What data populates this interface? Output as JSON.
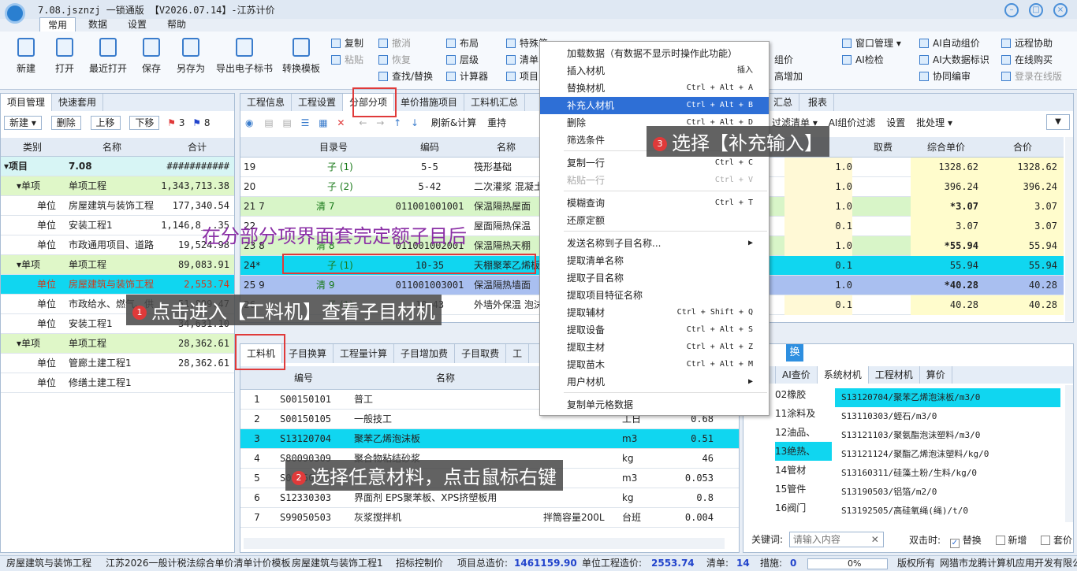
{
  "app": {
    "title": "7.08.jsznzj 一锁通版 【V2026.07.14】-江苏计价"
  },
  "menu": [
    "常用",
    "数据",
    "设置",
    "帮助"
  ],
  "ribbon": {
    "big": [
      "新建",
      "打开",
      "最近打开",
      "保存",
      "另存为",
      "导出电子标书",
      "转换模板"
    ],
    "small_col1": [
      "复制",
      "粘贴"
    ],
    "small_col2": [
      "撤消",
      "恢复",
      "查找/替换"
    ],
    "small_col3": [
      "布局",
      "层级",
      "计算器"
    ],
    "small_col4": [
      "特殊简…",
      "清单",
      "项目"
    ],
    "small_right1": [
      "窗口管理",
      "AI检检"
    ],
    "small_right2": [
      "AI自动组价",
      "AI大数据标识",
      "协同编审"
    ],
    "small_right3": [
      "远程协助",
      "在线购买",
      "登录在线版"
    ],
    "partial": [
      "组价",
      "高增加"
    ]
  },
  "left": {
    "tabs": [
      "项目管理",
      "快速套用"
    ],
    "toolbar": [
      "新建",
      "删除",
      "上移",
      "下移",
      "3",
      "8"
    ],
    "headers": [
      "类别",
      "名称",
      "合计"
    ],
    "rows": [
      {
        "cat": "项目",
        "name": "7.08",
        "total": "###########"
      },
      {
        "cat": "单项",
        "name": "单项工程",
        "total": "1,343,713.38"
      },
      {
        "cat": "单位",
        "name": "房屋建筑与装饰工程",
        "total": "177,340.54"
      },
      {
        "cat": "单位",
        "name": "安装工程1",
        "total": "1,146,8__.35"
      },
      {
        "cat": "单位",
        "name": "市政通用项目、道路",
        "total": "19,524.98"
      },
      {
        "cat": "单项",
        "name": "单项工程",
        "total": "89,083.91"
      },
      {
        "cat": "单位",
        "name": "房屋建筑与装饰工程",
        "total": "2,553.74"
      },
      {
        "cat": "单位",
        "name": "市政给水、燃气、供",
        "total": "51,899.47"
      },
      {
        "cat": "单位",
        "name": "安装工程1",
        "total": "34,631.10"
      },
      {
        "cat": "单项",
        "name": "单项工程",
        "total": "28,362.61"
      },
      {
        "cat": "单位",
        "name": "管廊土建工程1",
        "total": "28,362.61"
      },
      {
        "cat": "单位",
        "name": "修缮土建工程1",
        "total": ""
      }
    ]
  },
  "center": {
    "tabs": [
      "工程信息",
      "工程设置",
      "分部分项",
      "单价措施项目",
      "工料机汇总"
    ],
    "tabs_right": [
      "汇总",
      "报表"
    ],
    "toolbar": [
      "刷新&计算",
      "重持"
    ],
    "toolbar_right": [
      "过滤清单",
      "AI组价过滤",
      "设置",
      "批处理"
    ],
    "headers": [
      "目录号",
      "编码",
      "名称"
    ],
    "headers_right": [
      "",
      "取费",
      "综合单价",
      "合价"
    ],
    "rows": [
      {
        "no": "19",
        "dir": "子  (1)",
        "code": "5-5",
        "name": "筏形基础",
        "qty": "1.0",
        "unit": "1328.62",
        "total": "1328.62"
      },
      {
        "no": "20",
        "dir": "子  (2)",
        "code": "5-42",
        "name": "二次灌浆 混凝土",
        "qty": "1.0",
        "unit": "396.24",
        "total": "396.24"
      },
      {
        "no": "21 7",
        "dir": "清  7",
        "code": "011001001001",
        "name": "保温隔热屋面",
        "qty": "1.0",
        "unit": "*3.07",
        "total": "3.07"
      },
      {
        "no": "22",
        "dir": "",
        "code": "",
        "name": "屋面隔热保温",
        "qty": "0.1",
        "unit": "3.07",
        "total": "3.07"
      },
      {
        "no": "23 8",
        "dir": "清  8",
        "code": "011001002001",
        "name": "保温隔热天棚",
        "qty": "1.0",
        "unit": "*55.94",
        "total": "55.94"
      },
      {
        "no": "24*",
        "dir": "子  (1)",
        "code": "10-35",
        "name": "天棚聚苯乙烯板",
        "qty": "0.1",
        "unit": "55.94",
        "total": "55.94"
      },
      {
        "no": "25 9",
        "dir": "清  9",
        "code": "011001003001",
        "name": "保温隔热墙面",
        "qty": "1.0",
        "unit": "*40.28",
        "total": "40.28"
      },
      {
        "no": "26",
        "dir": "子  (1)",
        "code": "10-43",
        "name": "外墙外保温 泡沫",
        "qty": "0.1",
        "unit": "40.28",
        "total": "40.28"
      }
    ]
  },
  "bottom": {
    "tabs": [
      "工料机",
      "子目换算",
      "工程量计算",
      "子目增加费",
      "子目取费",
      "工"
    ],
    "headers": [
      "编号",
      "名称"
    ],
    "rows": [
      {
        "no": "1",
        "code": "S00150101",
        "name": "普工",
        "spec": "",
        "unit": "",
        "qty": ""
      },
      {
        "no": "2",
        "code": "S00150105",
        "name": "一般技工",
        "spec": "",
        "unit": "工日",
        "qty": "0.68"
      },
      {
        "no": "3",
        "code": "S13120704",
        "name": "聚苯乙烯泡沫板",
        "spec": "",
        "unit": "m3",
        "qty": "0.51"
      },
      {
        "no": "4",
        "code": "S80090309",
        "name": "聚合物粘结砂浆",
        "spec": "",
        "unit": "kg",
        "qty": "46"
      },
      {
        "no": "5",
        "code": "S01150…",
        "name": "",
        "spec": "",
        "unit": "m3",
        "qty": "0.053"
      },
      {
        "no": "6",
        "code": "S12330303",
        "name": "界面剂 EPS聚苯板、XPS挤塑板用",
        "spec": "",
        "unit": "kg",
        "qty": "0.8"
      },
      {
        "no": "7",
        "code": "S99050503",
        "name": "灰浆搅拌机",
        "spec": "拌筒容量200L",
        "unit": "台班",
        "qty": "0.004"
      }
    ]
  },
  "right": {
    "top_tabs": [
      "备",
      "换"
    ],
    "tabs": [
      "基价",
      "AI查价",
      "系统材机",
      "工程材机",
      "算价"
    ],
    "tree": [
      "02橡胶",
      "11涂料及",
      "12油品、",
      "13绝热、",
      "14管材",
      "15管件",
      "16阀门"
    ],
    "list": [
      "S13120704/聚苯乙烯泡沫板/m3/0",
      "S13110303/蛭石/m3/0",
      "S13121103/聚氨酯泡沫塑料/m3/0",
      "S13121124/聚酯乙烯泡沫塑料/kg/0",
      "S13160311/硅藻土粉/生料/kg/0",
      "S13190503/铝箔/m2/0",
      "S13192505/高硅氧绳(绳)/t/0"
    ],
    "search_label": "关键词:",
    "search_placeholder": "请输入内容",
    "dbl_label": "双击时:",
    "opt1": "替换",
    "opt2": "新增",
    "opt3": "套价"
  },
  "context_menu": [
    {
      "label": "加载数据（有数据不显示时操作此功能）",
      "shortcut": ""
    },
    {
      "label": "插入材机",
      "shortcut": "插入"
    },
    {
      "label": "替换材机",
      "shortcut": "Ctrl + Alt + A"
    },
    {
      "label": "补充人材机",
      "shortcut": "Ctrl + Alt + B"
    },
    {
      "label": "删除",
      "shortcut": "Ctrl + Alt + D"
    },
    {
      "label": "筛选条件",
      "shortcut": ""
    },
    {
      "label": "复制一行",
      "shortcut": "Ctrl + C"
    },
    {
      "label": "粘贴一行",
      "shortcut": "Ctrl + V"
    },
    {
      "label": "模糊查询",
      "shortcut": "Ctrl + T"
    },
    {
      "label": "还原定额",
      "shortcut": ""
    },
    {
      "label": "发送名称到子目名称...",
      "shortcut": "▶"
    },
    {
      "label": "提取清单名称",
      "shortcut": ""
    },
    {
      "label": "提取子目名称",
      "shortcut": ""
    },
    {
      "label": "提取项目特征名称",
      "shortcut": ""
    },
    {
      "label": "提取辅材",
      "shortcut": "Ctrl + Shift + Q"
    },
    {
      "label": "提取设备",
      "shortcut": "Ctrl + Alt + S"
    },
    {
      "label": "提取主材",
      "shortcut": "Ctrl + Alt + Z"
    },
    {
      "label": "提取苗木",
      "shortcut": "Ctrl + Alt + M"
    },
    {
      "label": "用户材机",
      "shortcut": "▶"
    },
    {
      "label": "复制单元格数据",
      "shortcut": ""
    }
  ],
  "annotations": {
    "a1": "点击进入【工料机】查看子目材机",
    "a2": "选择任意材料，点击鼠标右键",
    "a3": "选择【补充输入】",
    "purple": "在分部分项界面套完定额子目后",
    "n1": "1",
    "n2": "2",
    "n3": "3"
  },
  "status": [
    "房屋建筑与装饰工程",
    "江苏2026一般计税法综合单价清单计价模板",
    "房屋建筑与装饰工程1",
    "招标控制价",
    "项目总造价:",
    "1461159.90",
    "单位工程造价:",
    "2553.74",
    "清单:",
    "14",
    "措施:",
    "0",
    "0%",
    "版权所有",
    "网猎市龙腾计算机应用开发有限公司"
  ]
}
